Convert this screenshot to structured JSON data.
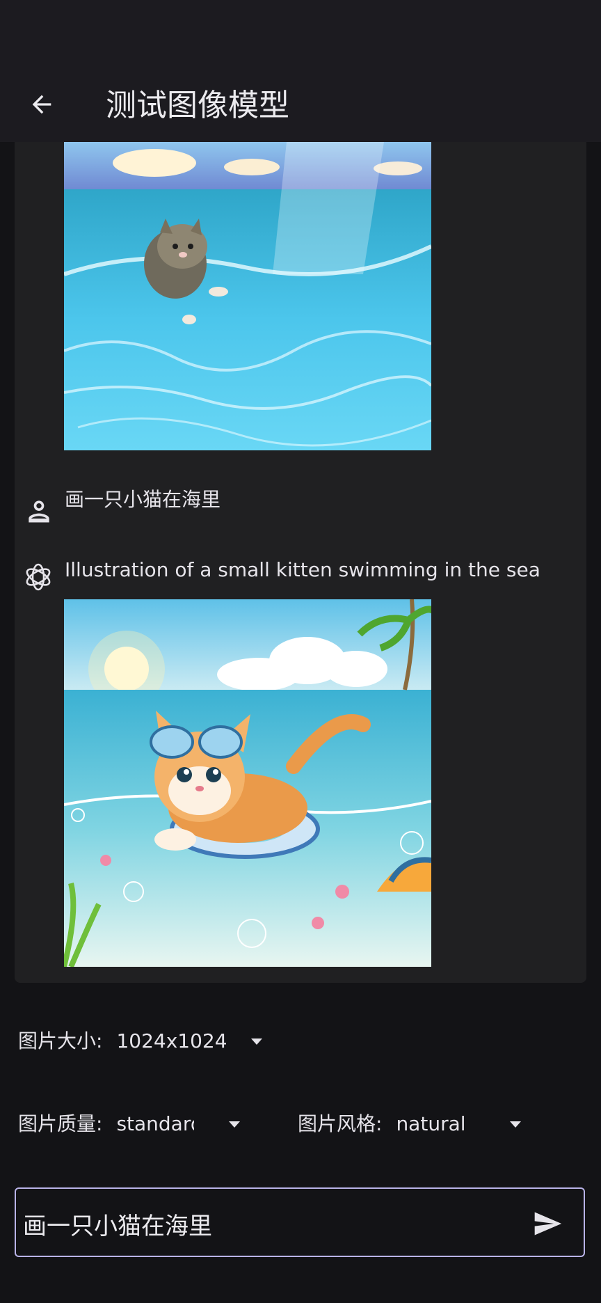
{
  "app_bar": {
    "title": "测试图像模型",
    "back_icon": "arrow-back-icon"
  },
  "messages": [
    {
      "role": "assistant",
      "image_alt": "kitten swimming in clear sea water"
    },
    {
      "role": "user",
      "text": "画一只小猫在海里"
    },
    {
      "role": "assistant",
      "text": "Illustration of a small kitten swimming in the sea",
      "image_alt": "cartoon kitten with goggles swimming with an inflatable ring in the sea"
    }
  ],
  "options": {
    "size_label": "图片大小:",
    "size_value": "1024x1024",
    "quality_label": "图片质量:",
    "quality_value": "standard",
    "style_label": "图片风格:",
    "style_value": "natural"
  },
  "input": {
    "value": "画一只小猫在海里",
    "send_icon": "send-icon"
  },
  "colors": {
    "background": "#131316",
    "card": "#202022",
    "input_border": "#b9b3e8"
  }
}
